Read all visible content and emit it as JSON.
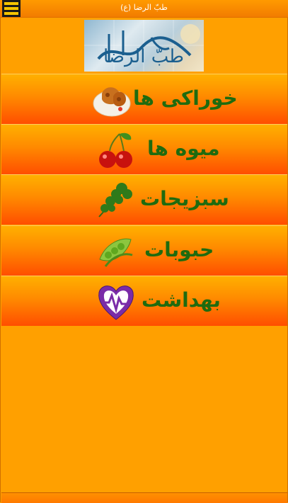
{
  "header": {
    "title": "طبّ الرضا (ع)",
    "menu_icon": "hamburger-menu-icon"
  },
  "banner": {
    "calligraphy": "طبّ الرضا",
    "icon": "calligraphy-banner"
  },
  "categories": [
    {
      "label": "خوراکی ها",
      "icon": "pastry-icon"
    },
    {
      "label": "میوه ها",
      "icon": "cherry-icon"
    },
    {
      "label": "سبزیجات",
      "icon": "herb-icon"
    },
    {
      "label": "حبوبات",
      "icon": "peas-icon"
    },
    {
      "label": "بهداشت",
      "icon": "heart-pulse-icon"
    }
  ],
  "colors": {
    "background": "#ffa000",
    "label_green": "#1f6b0f",
    "menu_yellow": "#f5c400"
  }
}
